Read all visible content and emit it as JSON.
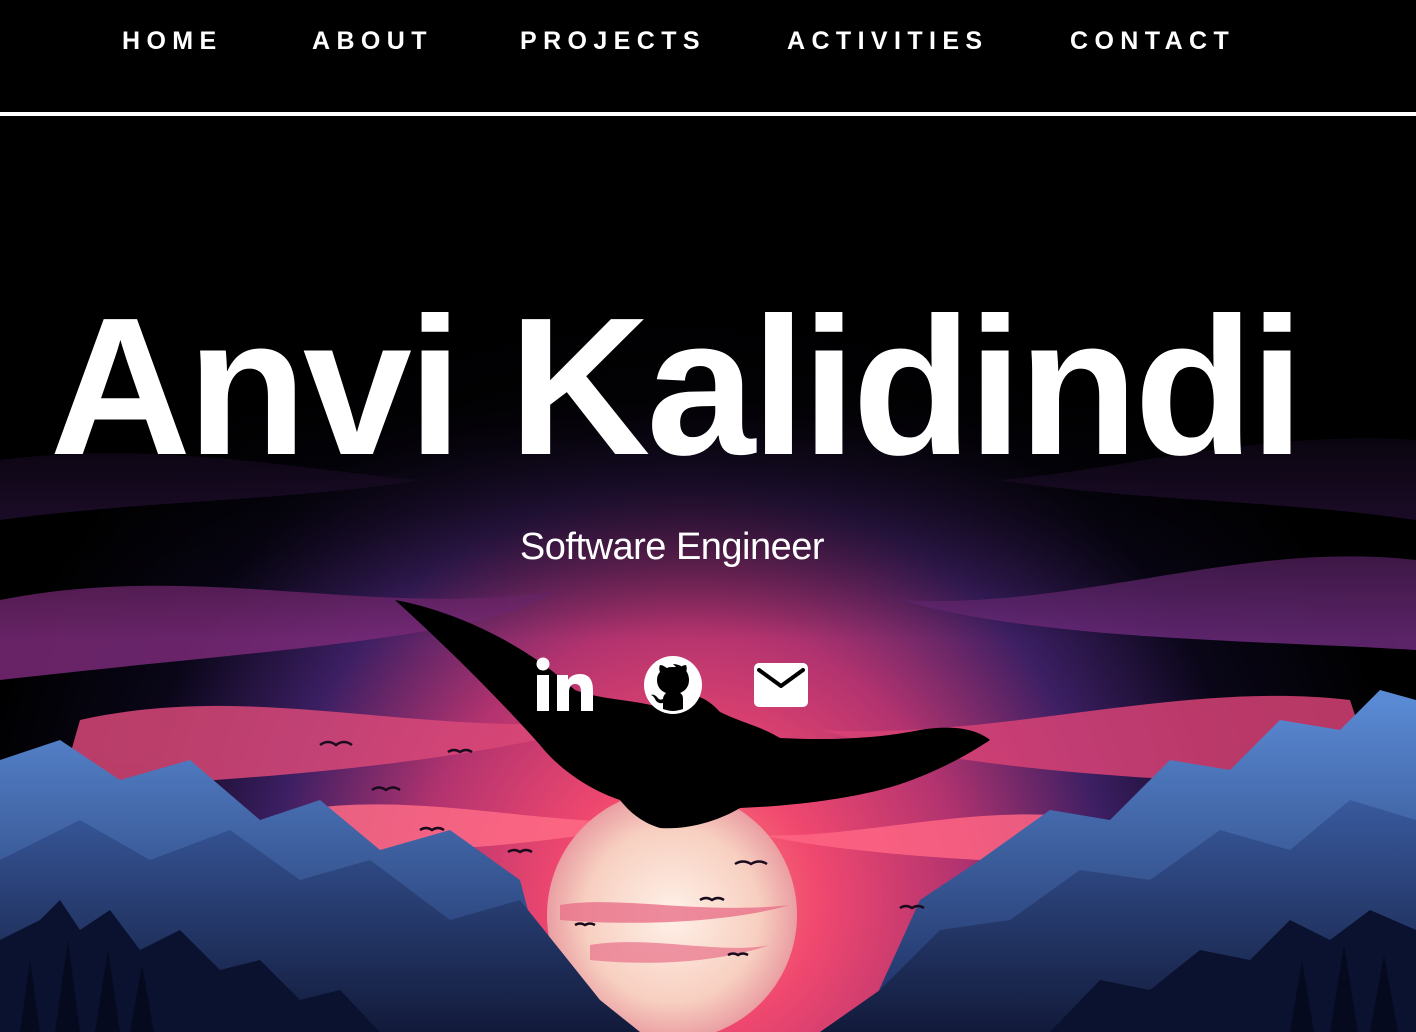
{
  "nav": {
    "items": [
      {
        "label": "HOME"
      },
      {
        "label": "ABOUT"
      },
      {
        "label": "PROJECTS"
      },
      {
        "label": "ACTIVITIES"
      },
      {
        "label": "CONTACT"
      }
    ]
  },
  "hero": {
    "name": "Anvi Kalidindi",
    "role": "Software Engineer",
    "social": [
      {
        "icon": "linkedin-icon"
      },
      {
        "icon": "github-icon"
      },
      {
        "icon": "mail-icon"
      }
    ]
  },
  "colors": {
    "background": "#000000",
    "text": "#ffffff",
    "sky_pink": "#e8456e",
    "sky_purple": "#3a1f6b",
    "mountain_blue": "#2e4f8f",
    "sun": "#f6d3c8"
  }
}
